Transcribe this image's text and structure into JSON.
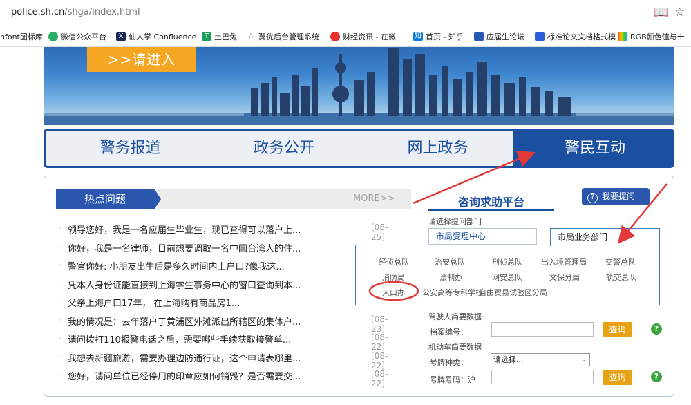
{
  "browser": {
    "url_host": "police.sh.cn",
    "url_path": "/shga/index.html",
    "bookmarks": [
      {
        "label": "nfont图标库",
        "icon": "iconfont-icon"
      },
      {
        "label": "微信公众平台",
        "icon": "wechat-icon"
      },
      {
        "label": "仙人掌 Confluence",
        "icon": "confluence-icon"
      },
      {
        "label": "土巴兔",
        "icon": "tubatu-icon"
      },
      {
        "label": "翼优后台管理系统",
        "icon": "star-icon"
      },
      {
        "label": "财经资讯 - 在微",
        "icon": "weibo-icon"
      },
      {
        "label": "首页 - 知乎",
        "icon": "zhihu-icon"
      },
      {
        "label": "应届生论坛",
        "icon": "forum-icon"
      },
      {
        "label": "标准论文文档格式模",
        "icon": "baidu-icon"
      },
      {
        "label": "RGB颜色值与十",
        "icon": "rainbow-icon"
      }
    ]
  },
  "banner": {
    "enter_label": ">>请进入"
  },
  "main_nav": {
    "tabs": [
      {
        "label": "警务报道",
        "active": false
      },
      {
        "label": "政务公开",
        "active": false
      },
      {
        "label": "网上政务",
        "active": false
      },
      {
        "label": "警民互动",
        "active": true
      }
    ]
  },
  "hot": {
    "title": "热点问题",
    "more": "MORE>>",
    "items": [
      {
        "text": "领导您好，我是一名应届生毕业生，现已查得可以落户上...",
        "date": "[08-25]"
      },
      {
        "text": "你好，我是一名律师，目前想要调取一名中国台湾人的住...",
        "date": ""
      },
      {
        "text": "警官你好: 小朋友出生后是多久时间内上户口?像我这...",
        "date": ""
      },
      {
        "text": "凭本人身份证能直接到上海学生事务中心的窗口查询到本...",
        "date": ""
      },
      {
        "text": "父亲上海户口17年， 在上海购有商品房1...",
        "date": ""
      },
      {
        "text": "我的情况是：去年落户于黄浦区外滩派出所辖区的集体户...",
        "date": "[08-23]"
      },
      {
        "text": "请问拨打110报警电话之后，需要哪些手续获取接警单...",
        "date": "[08-22]"
      },
      {
        "text": "我想去新疆旅游，需要办理边防通行证，这个申请表哪里...",
        "date": "[08-22]"
      },
      {
        "text": "您好，请问单位已经停用的印章应如何销毁？是否需要交...",
        "date": "[08-22]"
      }
    ]
  },
  "consult": {
    "title": "咨询求助平台",
    "ask_label": "我要提问",
    "select_dept_label": "请选择提问部门",
    "dept_tab_center": "市局受理中心",
    "dept_tab_business": "市局业务部门",
    "depts": [
      "经侦总队",
      "治安总队",
      "刑侦总队",
      "出入境管理局",
      "交警总队",
      "消防局",
      "法制办",
      "网安总队",
      "文保分局",
      "轨交总队",
      "人口办",
      "公安高等专科学校",
      "自由贸易试验区分局"
    ]
  },
  "forms": {
    "driver_title": "驾驶人简要数据",
    "archive_label": "档案编号：",
    "query_label": "查询",
    "vehicle_title": "机动车简要数据",
    "plate_type_label": "号牌种类：",
    "plate_type_value": "请选择...",
    "plate_number_label": "号牌号码：沪"
  },
  "colors": {
    "brand_blue": "#1b4fa0",
    "accent_orange": "#f5a623",
    "annotation_red": "#e23a3a"
  }
}
